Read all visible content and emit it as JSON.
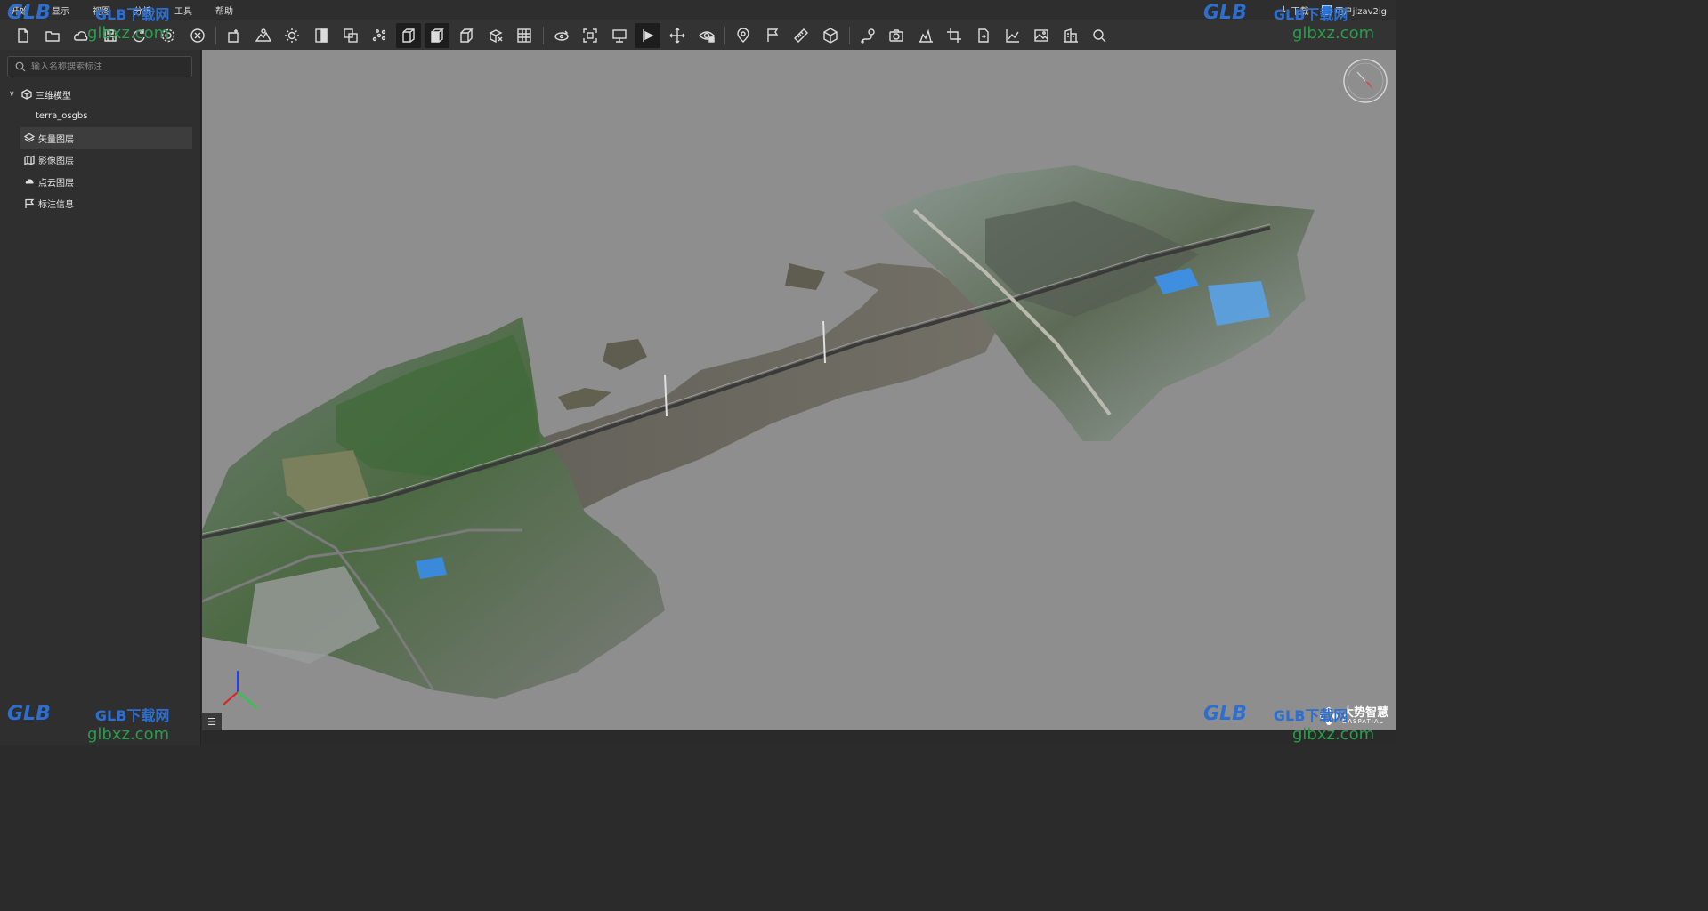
{
  "menu": {
    "items": [
      "开始",
      "显示",
      "视图",
      "分析",
      "工具",
      "帮助"
    ],
    "download": "下载",
    "user": "用户jlzav2ig"
  },
  "toolbar": {
    "icons": [
      "new-file-icon",
      "open-folder-icon",
      "cloud-icon",
      "save-icon",
      "refresh-icon",
      "settings-icon",
      "close-circle-icon",
      "add-layer-icon",
      "terrain-icon",
      "sun-icon",
      "shadow-icon",
      "layer-compare-icon",
      "points-icon",
      "cube-outline-icon",
      "cube-solid-icon",
      "cube-wire-icon",
      "cube-clip-icon",
      "grid-icon",
      "orbit-icon",
      "fullscreen-icon",
      "monitor-icon",
      "flag-play-icon",
      "move-icon",
      "view-lock-icon",
      "location-pin-icon",
      "flag-icon",
      "ruler-icon",
      "box-icon",
      "route-icon",
      "camera-icon",
      "profile-icon",
      "crop-icon",
      "export-icon",
      "chart-icon",
      "image-icon",
      "building-icon",
      "search-icon"
    ],
    "active": [
      "cube-outline-icon",
      "cube-solid-icon",
      "flag-play-icon"
    ],
    "separators_after": [
      "close-circle-icon",
      "grid-icon",
      "view-lock-icon",
      "box-icon"
    ]
  },
  "sidebar": {
    "search_placeholder": "输入名称搜索标注",
    "tree": [
      {
        "label": "三维模型",
        "icon": "cube-icon",
        "expanded": true,
        "level": 0
      },
      {
        "label": "terra_osgbs",
        "icon": "",
        "level": 1
      },
      {
        "label": "矢量图层",
        "icon": "layers-icon",
        "level": 0,
        "selected": true
      },
      {
        "label": "影像图层",
        "icon": "map-icon",
        "level": 0
      },
      {
        "label": "点云图层",
        "icon": "cloud-points-icon",
        "level": 0
      },
      {
        "label": "标注信息",
        "icon": "flag-icon",
        "level": 0
      }
    ]
  },
  "viewport": {
    "background": "#8e8e8e",
    "brand_cn": "大势智慧",
    "brand_en": "DASPATIAL"
  },
  "watermark": {
    "logo": "GLB",
    "cn": "GLB下载网",
    "url": "glbxz.com"
  },
  "colors": {
    "accent": "#2f7fd6",
    "watermark_blue": "#2d6fd0",
    "watermark_green": "#2a9c4b"
  }
}
